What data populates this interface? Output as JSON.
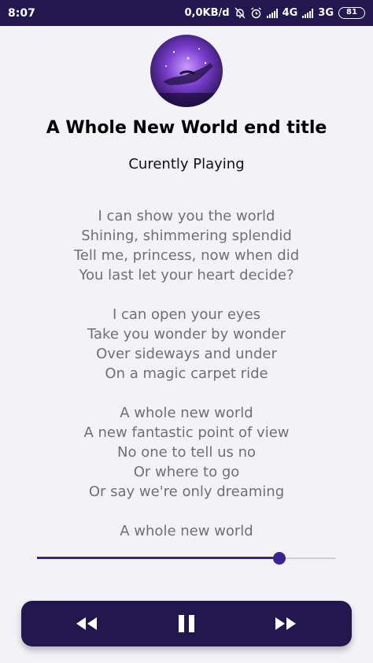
{
  "status_bar": {
    "time": "8:07",
    "data_rate": "0,0KB/d",
    "net1": "4G",
    "net2": "3G",
    "battery": "81",
    "icons": [
      "notifications-off-icon",
      "alarm-icon",
      "signal-icon",
      "signal-icon",
      "battery-icon"
    ]
  },
  "player": {
    "title": "A Whole New World end title",
    "subtitle": "Curently Playing",
    "album_art_icon": "magic-lamp-art",
    "progress": 0.81
  },
  "lyrics": {
    "stanzas": [
      [
        "I can show you the world",
        "Shining, shimmering splendid",
        "Tell me, princess, now when did",
        "You last let your heart decide?"
      ],
      [
        "I can open your eyes",
        "Take you wonder by wonder",
        "Over sideways and under",
        "On a magic carpet ride"
      ],
      [
        "A whole new world",
        "A new fantastic point of view",
        "No one to tell us no",
        "Or where to go",
        "Or say we're only dreaming"
      ],
      [
        "A whole new world"
      ]
    ]
  },
  "controls": {
    "icons": [
      "rewind-icon",
      "pause-icon",
      "fast-forward-icon"
    ]
  },
  "colors": {
    "status_bar": "#23174f",
    "accent": "#3b2196",
    "background": "#f3f2f7",
    "lyrics_text": "#707070"
  }
}
